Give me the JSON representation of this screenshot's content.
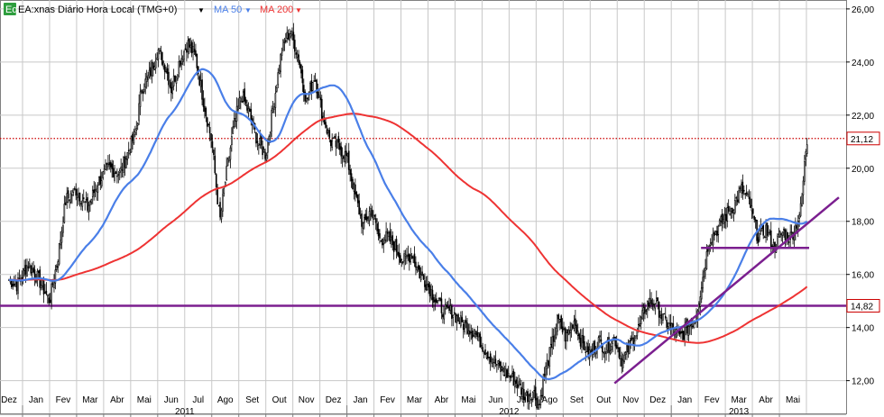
{
  "chart_data": {
    "type": "candlestick",
    "legend": {
      "badge": "Eq",
      "symbol_label": "EA:xnas Diário Hora Local (TMG+0)",
      "ma50_label": "MA 50",
      "ma200_label": "MA 200"
    },
    "colors": {
      "background": "#ffffff",
      "grid": "#c8c8c8",
      "candle": "#000000",
      "ma50": "#4a7fe8",
      "ma200": "#ee3333",
      "trendline": "#7b1f8f",
      "price_line": "#cc0000",
      "badge_bg": "#2e9e3e"
    },
    "y_axis": {
      "min": 10.8,
      "max": 26.2,
      "ticks": [
        "12,00",
        "14,00",
        "16,00",
        "18,00",
        "20,00",
        "22,00",
        "24,00",
        "26,00"
      ],
      "tick_values": [
        12,
        14,
        16,
        18,
        20,
        22,
        24,
        26
      ],
      "position": "right"
    },
    "x_axis": {
      "months": [
        "Dez",
        "Jan",
        "Fev",
        "Mar",
        "Abr",
        "Mai",
        "Jun",
        "Jul",
        "Ago",
        "Set",
        "Out",
        "Nov",
        "Dez",
        "Jan",
        "Fev",
        "Mar",
        "Abr",
        "Mai",
        "Jun",
        "Jul",
        "Ago",
        "Set",
        "Out",
        "Nov",
        "Dez",
        "Jan",
        "Fev",
        "Mar",
        "Abr",
        "Mai"
      ],
      "years": [
        {
          "label": "2011",
          "start_index": 1,
          "end_index": 12
        },
        {
          "label": "2012",
          "start_index": 13,
          "end_index": 24
        },
        {
          "label": "2013",
          "start_index": 25,
          "end_index": 29
        }
      ]
    },
    "horizontal_lines": [
      {
        "name": "last-price",
        "value": 21.12,
        "label": "21,12",
        "style": "dotted"
      },
      {
        "name": "support",
        "value": 14.82,
        "label": "14,82",
        "style": "solid"
      }
    ],
    "trendlines": [
      {
        "name": "rising-trendline",
        "x_start": 22.4,
        "y_start": 11.9,
        "x_end": 30.7,
        "y_end": 18.9
      },
      {
        "name": "short-horizontal",
        "x_start": 25.6,
        "y_start": 17.0,
        "x_end": 29.6,
        "y_end": 17.0
      }
    ],
    "price_anchors": [
      [
        0.0,
        15.8
      ],
      [
        0.3,
        15.6
      ],
      [
        0.7,
        16.4
      ],
      [
        1.1,
        15.8
      ],
      [
        1.5,
        15.0
      ],
      [
        1.8,
        16.6
      ],
      [
        2.1,
        18.8
      ],
      [
        2.5,
        19.2
      ],
      [
        2.9,
        18.5
      ],
      [
        3.3,
        19.5
      ],
      [
        3.7,
        20.0
      ],
      [
        4.1,
        19.8
      ],
      [
        4.4,
        20.6
      ],
      [
        4.7,
        21.4
      ],
      [
        4.9,
        23.0
      ],
      [
        5.2,
        23.5
      ],
      [
        5.5,
        24.5
      ],
      [
        5.8,
        23.8
      ],
      [
        6.0,
        23.0
      ],
      [
        6.3,
        24.0
      ],
      [
        6.6,
        24.7
      ],
      [
        6.9,
        24.2
      ],
      [
        7.2,
        22.5
      ],
      [
        7.5,
        21.0
      ],
      [
        7.8,
        18.0
      ],
      [
        8.0,
        19.5
      ],
      [
        8.3,
        21.5
      ],
      [
        8.6,
        22.8
      ],
      [
        8.9,
        22.0
      ],
      [
        9.2,
        21.0
      ],
      [
        9.5,
        20.5
      ],
      [
        9.8,
        22.5
      ],
      [
        10.1,
        24.5
      ],
      [
        10.4,
        25.2
      ],
      [
        10.7,
        24.2
      ],
      [
        11.0,
        22.5
      ],
      [
        11.3,
        23.5
      ],
      [
        11.6,
        22.0
      ],
      [
        11.9,
        21.0
      ],
      [
        12.2,
        20.8
      ],
      [
        12.5,
        20.4
      ],
      [
        12.8,
        19.0
      ],
      [
        13.1,
        17.8
      ],
      [
        13.4,
        18.5
      ],
      [
        13.7,
        17.3
      ],
      [
        14.0,
        17.4
      ],
      [
        14.3,
        17.0
      ],
      [
        14.6,
        16.5
      ],
      [
        14.9,
        16.8
      ],
      [
        15.2,
        16.0
      ],
      [
        15.5,
        15.6
      ],
      [
        15.8,
        15.0
      ],
      [
        16.1,
        14.6
      ],
      [
        16.4,
        14.6
      ],
      [
        16.7,
        14.2
      ],
      [
        17.0,
        14.0
      ],
      [
        17.3,
        13.7
      ],
      [
        17.6,
        13.2
      ],
      [
        17.9,
        12.8
      ],
      [
        18.2,
        12.4
      ],
      [
        18.5,
        12.2
      ],
      [
        18.8,
        11.9
      ],
      [
        19.1,
        11.4
      ],
      [
        19.4,
        11.6
      ],
      [
        19.6,
        11.0
      ],
      [
        19.8,
        12.2
      ],
      [
        20.0,
        13.0
      ],
      [
        20.3,
        14.3
      ],
      [
        20.6,
        13.6
      ],
      [
        20.9,
        14.3
      ],
      [
        21.2,
        13.4
      ],
      [
        21.5,
        13.0
      ],
      [
        21.8,
        13.5
      ],
      [
        22.1,
        13.2
      ],
      [
        22.4,
        13.6
      ],
      [
        22.7,
        12.7
      ],
      [
        23.0,
        13.4
      ],
      [
        23.3,
        14.0
      ],
      [
        23.6,
        14.9
      ],
      [
        23.9,
        15.0
      ],
      [
        24.2,
        14.3
      ],
      [
        24.5,
        14.0
      ],
      [
        24.8,
        13.6
      ],
      [
        25.1,
        14.0
      ],
      [
        25.4,
        14.4
      ],
      [
        25.6,
        15.5
      ],
      [
        25.9,
        17.3
      ],
      [
        26.2,
        17.7
      ],
      [
        26.5,
        18.2
      ],
      [
        26.8,
        18.6
      ],
      [
        27.1,
        19.2
      ],
      [
        27.4,
        18.7
      ],
      [
        27.7,
        17.4
      ],
      [
        28.0,
        17.7
      ],
      [
        28.3,
        17.0
      ],
      [
        28.6,
        17.6
      ],
      [
        28.9,
        17.4
      ],
      [
        29.1,
        17.8
      ],
      [
        29.3,
        18.5
      ],
      [
        29.5,
        21.0
      ]
    ],
    "price_range": {
      "min": 10.9,
      "max": 25.6
    }
  }
}
